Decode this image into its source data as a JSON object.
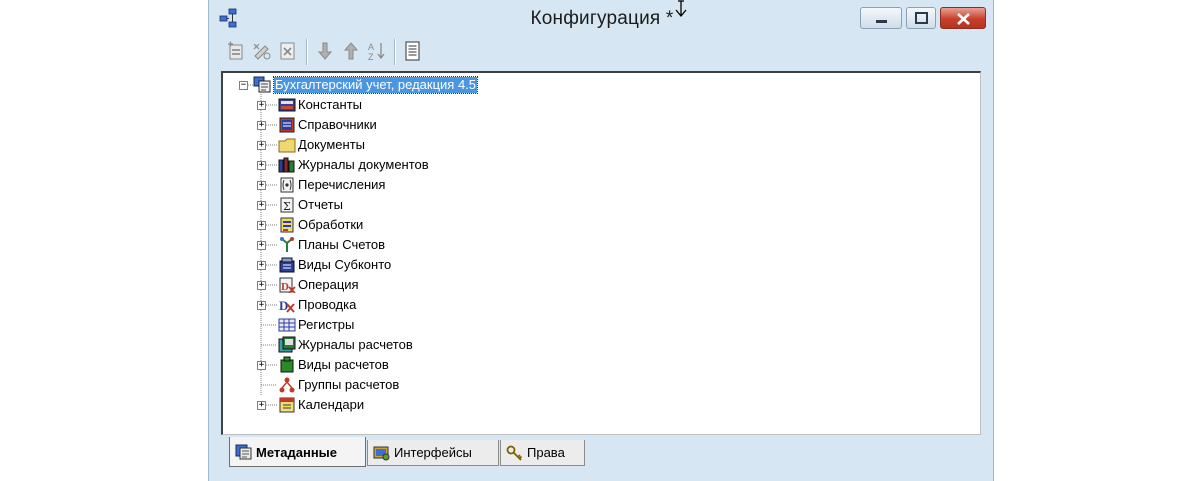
{
  "window": {
    "title": "Конфигурация *",
    "icons": {
      "app": "config-tree-icon",
      "minimize": "minimize-icon",
      "maximize": "maximize-icon",
      "close": "close-icon"
    }
  },
  "toolbar": {
    "buttons": [
      "new-item-icon",
      "edit-properties-icon",
      "delete-icon",
      "move-down-icon",
      "move-up-icon",
      "sort-icon",
      "description-icon"
    ]
  },
  "tree": {
    "root": {
      "label": "Бухгалтерский учет, редакция 4.5",
      "expanded": true,
      "selected": true
    },
    "items": [
      {
        "label": "Константы",
        "icon": "constants-icon",
        "expandable": true
      },
      {
        "label": "Справочники",
        "icon": "catalogs-icon",
        "expandable": true
      },
      {
        "label": "Документы",
        "icon": "documents-folder-icon",
        "expandable": true
      },
      {
        "label": "Журналы документов",
        "icon": "document-journals-icon",
        "expandable": true
      },
      {
        "label": "Перечисления",
        "icon": "enumerations-icon",
        "expandable": true
      },
      {
        "label": "Отчеты",
        "icon": "reports-icon",
        "expandable": true
      },
      {
        "label": "Обработки",
        "icon": "data-processors-icon",
        "expandable": true
      },
      {
        "label": "Планы Счетов",
        "icon": "chart-of-accounts-icon",
        "expandable": true
      },
      {
        "label": "Виды Субконто",
        "icon": "subconto-kinds-icon",
        "expandable": true
      },
      {
        "label": "Операция",
        "icon": "operation-icon",
        "expandable": true
      },
      {
        "label": "Проводка",
        "icon": "entry-icon",
        "expandable": true
      },
      {
        "label": "Регистры",
        "icon": "registers-icon",
        "expandable": false
      },
      {
        "label": "Журналы расчетов",
        "icon": "calculation-journals-icon",
        "expandable": false
      },
      {
        "label": "Виды расчетов",
        "icon": "calculation-kinds-icon",
        "expandable": true
      },
      {
        "label": "Группы расчетов",
        "icon": "calculation-groups-icon",
        "expandable": false
      },
      {
        "label": "Календари",
        "icon": "calendars-icon",
        "expandable": true
      }
    ]
  },
  "tabs": [
    {
      "label": "Метаданные",
      "icon": "metadata-icon",
      "active": true
    },
    {
      "label": "Интерфейсы",
      "icon": "interfaces-icon",
      "active": false
    },
    {
      "label": "Права",
      "icon": "rights-icon",
      "active": false
    }
  ]
}
